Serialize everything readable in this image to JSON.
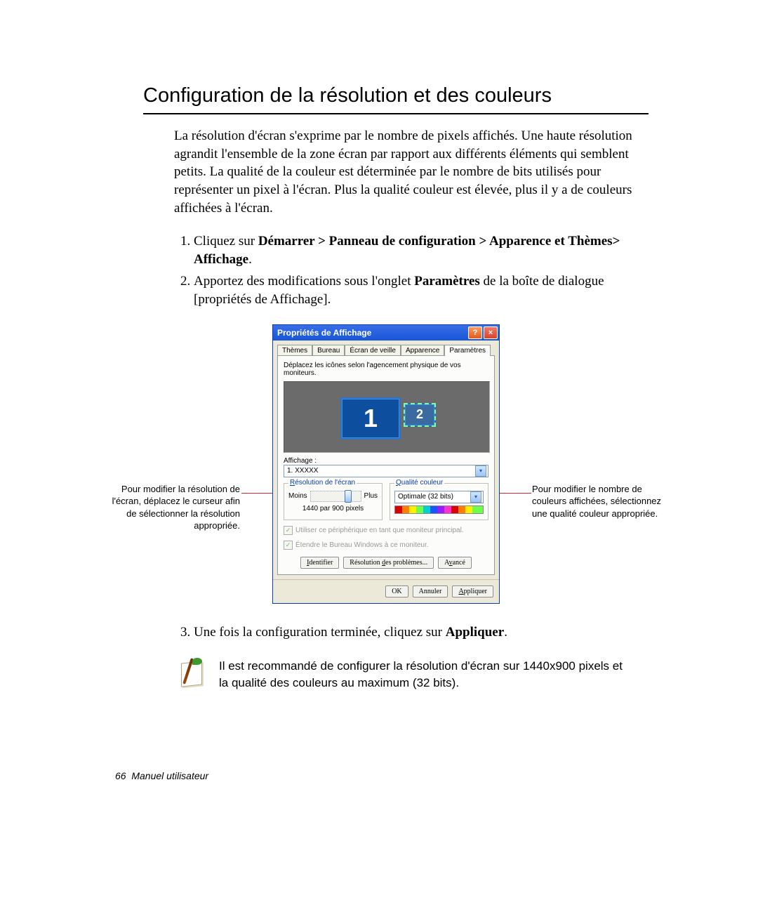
{
  "heading": "Configuration de la résolution et des couleurs",
  "intro": "La résolution d'écran s'exprime par le nombre de pixels affichés. Une haute résolution agrandit l'ensemble de la zone écran par rapport aux différents éléments qui semblent petits. La qualité de la couleur est déterminée par le nombre de bits utilisés pour représenter un pixel à l'écran. Plus la qualité couleur est élevée, plus il y a de couleurs affichées à l'écran.",
  "steps": {
    "s1_a": "Cliquez sur ",
    "s1_b": "Démarrer > Panneau de configuration > Apparence et Thèmes> Affichage",
    "s1_c": ".",
    "s2_a": "Apportez des modifications sous l'onglet ",
    "s2_b": "Paramètres",
    "s2_c": " de la boîte de dialogue [propriétés de Affichage].",
    "s3_a": "Une fois la configuration terminée, cliquez sur ",
    "s3_b": "Appliquer",
    "s3_c": "."
  },
  "callouts": {
    "left": "Pour modifier la résolution de l'écran, déplacez le curseur afin de sélectionner la résolution appropriée.",
    "right": "Pour modifier le nombre de couleurs affichées, sélectionnez une qualité couleur appropriée."
  },
  "dialog": {
    "title": "Propriétés de Affichage",
    "help": "?",
    "close": "×",
    "tabs": [
      "Thèmes",
      "Bureau",
      "Écran de veille",
      "Apparence",
      "Paramètres"
    ],
    "activeTab": 4,
    "instruction": "Déplacez les icônes selon l'agencement physique de vos moniteurs.",
    "mon1": "1",
    "mon2": "2",
    "affichage_label": "Affichage :",
    "affichage_value": "1. XXXXX",
    "grp_res": "Résolution de l'écran",
    "slider_less": "Moins",
    "slider_more": "Plus",
    "res_value": "1440 par 900 pixels",
    "grp_qual": "Qualité couleur",
    "quality_value": "Optimale (32 bits)",
    "chk1": "Utiliser ce périphérique en tant que moniteur principal.",
    "chk2": "Étendre le Bureau Windows à ce moniteur.",
    "btn_identify": "Identifier",
    "btn_troubleshoot": "Résolution des problèmes...",
    "btn_advanced": "Avancé",
    "btn_ok": "OK",
    "btn_cancel": "Annuler",
    "btn_apply": "Appliquer"
  },
  "note": "Il est recommandé de configurer la résolution d'écran sur 1440x900 pixels et la qualité des couleurs au maximum (32 bits).",
  "footer_page": "66",
  "footer_text": "Manuel utilisateur"
}
